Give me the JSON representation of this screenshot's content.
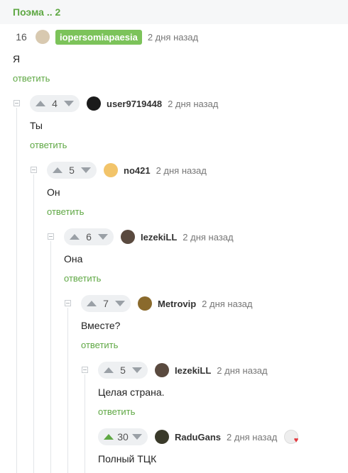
{
  "post": {
    "title": "Поэма .. 2"
  },
  "labels": {
    "reply": "ответить"
  },
  "comments": [
    {
      "rating": "16",
      "user": "iopersomiapaesia",
      "time": "2 дня назад",
      "text": "Я",
      "avatar_color": "#d8c9b0"
    },
    {
      "rating": "4",
      "user": "user9719448",
      "time": "2 дня назад",
      "text": "Ты",
      "avatar_color": "#1b1b1b"
    },
    {
      "rating": "5",
      "user": "no421",
      "time": "2 дня назад",
      "text": "Он",
      "avatar_color": "#f2c46a"
    },
    {
      "rating": "6",
      "user": "IezekiLL",
      "time": "2 дня назад",
      "text": "Она",
      "avatar_color": "#5a4a3f"
    },
    {
      "rating": "7",
      "user": "Metrovip",
      "time": "2 дня назад",
      "text": "Вместе?",
      "avatar_color": "#8a6a2c"
    },
    {
      "rating": "5",
      "user": "IezekiLL",
      "time": "2 дня назад",
      "text": "Целая страна.",
      "avatar_color": "#5a4a3f"
    },
    {
      "rating": "30",
      "user": "RaduGans",
      "time": "2 дня назад",
      "text": "Полный ТЦК",
      "avatar_color": "#3a3a2a",
      "upvoted": true
    }
  ]
}
